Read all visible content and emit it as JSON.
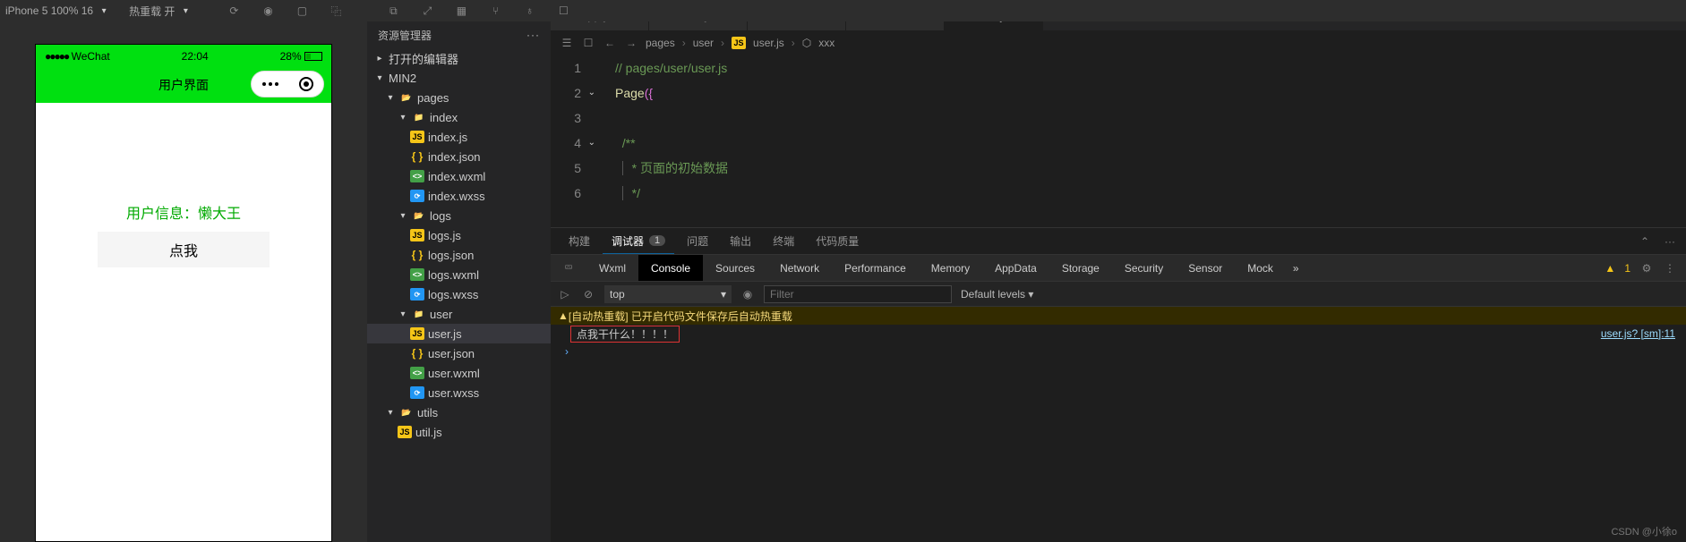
{
  "topbar": {
    "device": "iPhone 5 100% 16",
    "hot": "热重载 开"
  },
  "simulator": {
    "carrier": "WeChat",
    "time": "22:04",
    "battery": "28%",
    "title": "用户界面",
    "userinfo": "用户信息：懒大王",
    "button": "点我"
  },
  "explorer": {
    "title": "资源管理器",
    "openEditors": "打开的编辑器",
    "root": "MIN2",
    "folders": {
      "pages": "pages",
      "index": "index",
      "logs": "logs",
      "user": "user",
      "utils": "utils"
    },
    "files": {
      "index_js": "index.js",
      "index_json": "index.json",
      "index_wxml": "index.wxml",
      "index_wxss": "index.wxss",
      "logs_js": "logs.js",
      "logs_json": "logs.json",
      "logs_wxml": "logs.wxml",
      "logs_wxss": "logs.wxss",
      "user_js": "user.js",
      "user_json": "user.json",
      "user_wxml": "user.wxml",
      "user_wxss": "user.wxss",
      "util_js": "util.js"
    }
  },
  "tabs": {
    "app_json": "app.json",
    "user_json": "user.json",
    "user_wxml": "user.wxml",
    "user_wxss": "user.wxss",
    "user_js": "user.js"
  },
  "breadcrumb": {
    "pages": "pages",
    "user": "user",
    "user_js": "user.js",
    "xxx": "xxx"
  },
  "code": {
    "l1": "// pages/user/user.js",
    "l2a": "Page",
    "l2b": "({",
    "l4": "/**",
    "l5": " * 页面的初始数据",
    "l6": " */"
  },
  "panel": {
    "build": "构建",
    "debugger": "调试器",
    "badge": "1",
    "problems": "问题",
    "output": "输出",
    "terminal": "终端",
    "quality": "代码质量"
  },
  "devtools": {
    "wxml": "Wxml",
    "console": "Console",
    "sources": "Sources",
    "network": "Network",
    "performance": "Performance",
    "memory": "Memory",
    "appdata": "AppData",
    "storage": "Storage",
    "security": "Security",
    "sensor": "Sensor",
    "mock": "Mock",
    "warn_count": "1"
  },
  "console": {
    "ctx": "top",
    "filter_ph": "Filter",
    "levels": "Default levels",
    "warn": "[自动热重载]  已开启代码文件保存后自动热重载",
    "log": "点我干什么！！！！",
    "src": "user.js? [sm]:11"
  },
  "watermark": "CSDN @小徐o"
}
